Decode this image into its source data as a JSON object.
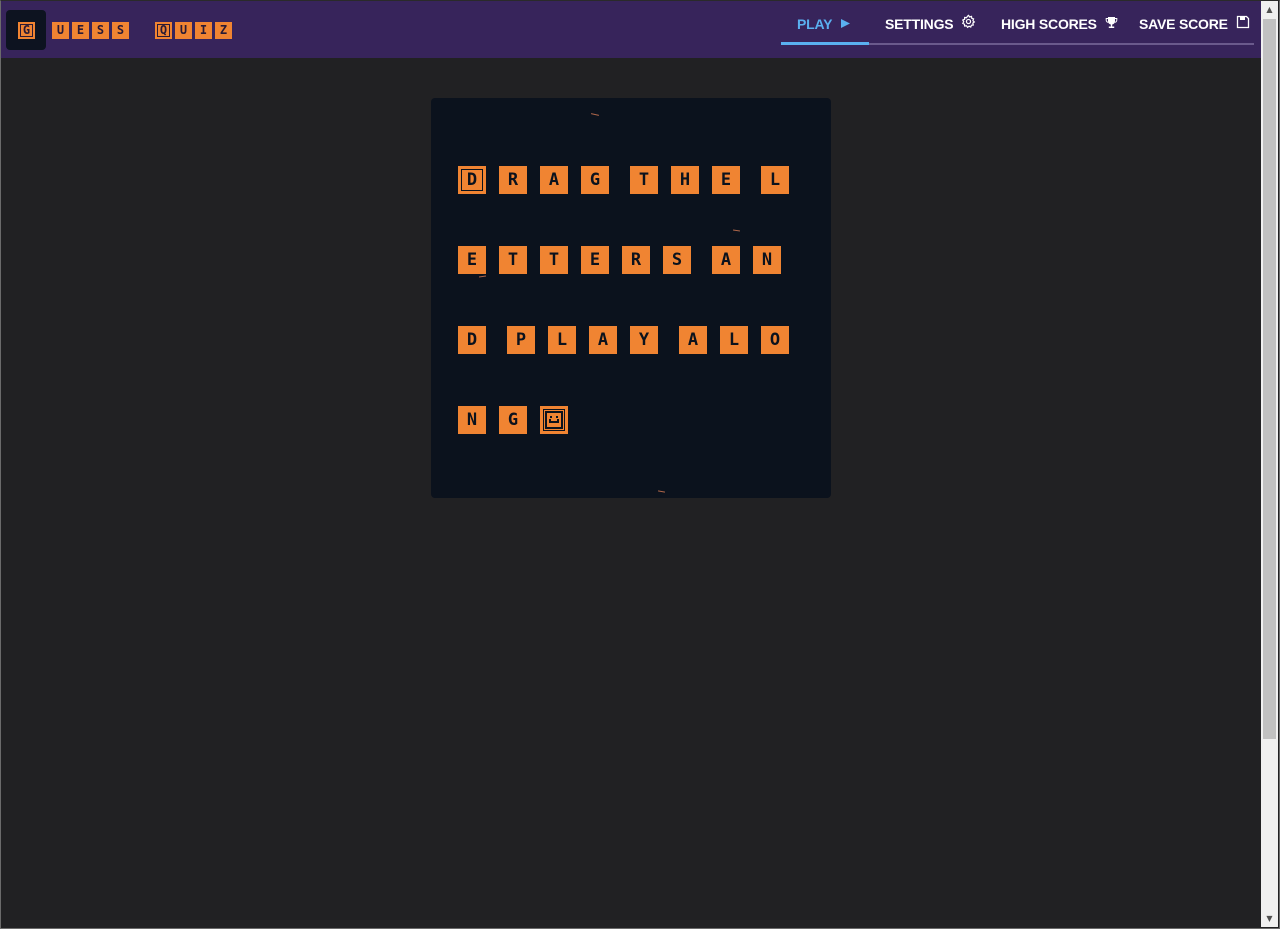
{
  "logo": {
    "first_letter": "G",
    "word1": [
      "U",
      "E",
      "S",
      "S"
    ],
    "word2_first": "Q",
    "word2": [
      "U",
      "I",
      "Z"
    ]
  },
  "nav": {
    "play": "PLAY",
    "settings": "SETTINGS",
    "high_scores": "HIGH SCORES",
    "save_score": "SAVE SCORE",
    "active": "PLAY"
  },
  "icons": {
    "play": "play-triangle-icon",
    "settings": "gear-icon",
    "high_scores": "trophy-icon",
    "save_score": "floppy-disk-icon"
  },
  "board": {
    "rows": [
      [
        "D",
        "R",
        "A",
        "G",
        " ",
        "T",
        "H",
        "E",
        " ",
        "L"
      ],
      [
        "E",
        "T",
        "T",
        "E",
        "R",
        "S",
        " ",
        "A",
        "N"
      ],
      [
        "D",
        " ",
        "P",
        "L",
        "A",
        "Y",
        " ",
        "A",
        "L",
        "O"
      ],
      [
        "N",
        "G",
        ":-)"
      ]
    ]
  },
  "colors": {
    "header_bg": "#37245b",
    "page_bg": "#212123",
    "board_bg": "#0b121d",
    "tile": "#f08432",
    "active_nav": "#5ab0f0"
  }
}
